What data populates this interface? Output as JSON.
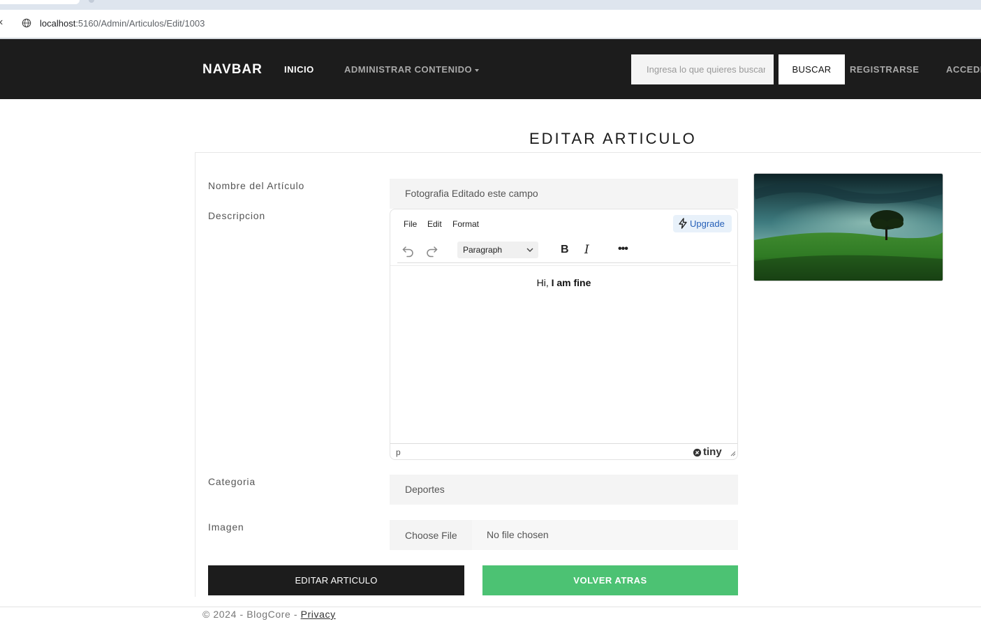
{
  "browser": {
    "url_host": "localhost",
    "url_rest": ":5160/Admin/Articulos/Edit/1003"
  },
  "navbar": {
    "brand": "NAVBAR",
    "inicio": "INICIO",
    "admin_menu": "ADMINISTRAR CONTENIDO",
    "search_placeholder": "Ingresa lo que quieres buscar",
    "search_button": "BUSCAR",
    "register": "REGISTRARSE",
    "login": "ACCEDER"
  },
  "page": {
    "title": "EDITAR ARTICULO"
  },
  "form": {
    "nombre_label": "Nombre del Artículo",
    "nombre_value": "Fotografia Editado este campo",
    "descripcion_label": "Descripcion",
    "categoria_label": "Categoria",
    "categoria_value": "Deportes",
    "imagen_label": "Imagen",
    "choose_file": "Choose File",
    "no_file": "No file chosen",
    "submit": "EDITAR ARTICULO",
    "back": "VOLVER ATRAS"
  },
  "editor": {
    "menu": [
      "File",
      "Edit",
      "Format"
    ],
    "upgrade": "Upgrade",
    "block_format": "Paragraph",
    "bold_label": "B",
    "italic_label": "I",
    "more_label": "•••",
    "content_plain": "Hi, ",
    "content_bold": "I am fine",
    "path": "p",
    "brand": "tiny"
  },
  "footer": {
    "text": "© 2024 - BlogCore - ",
    "privacy": "Privacy"
  },
  "colors": {
    "navbar_bg": "#1c1c1c",
    "primary_button": "#1c1c1c",
    "back_button": "#4cc273",
    "upgrade_text": "#2660b8"
  }
}
